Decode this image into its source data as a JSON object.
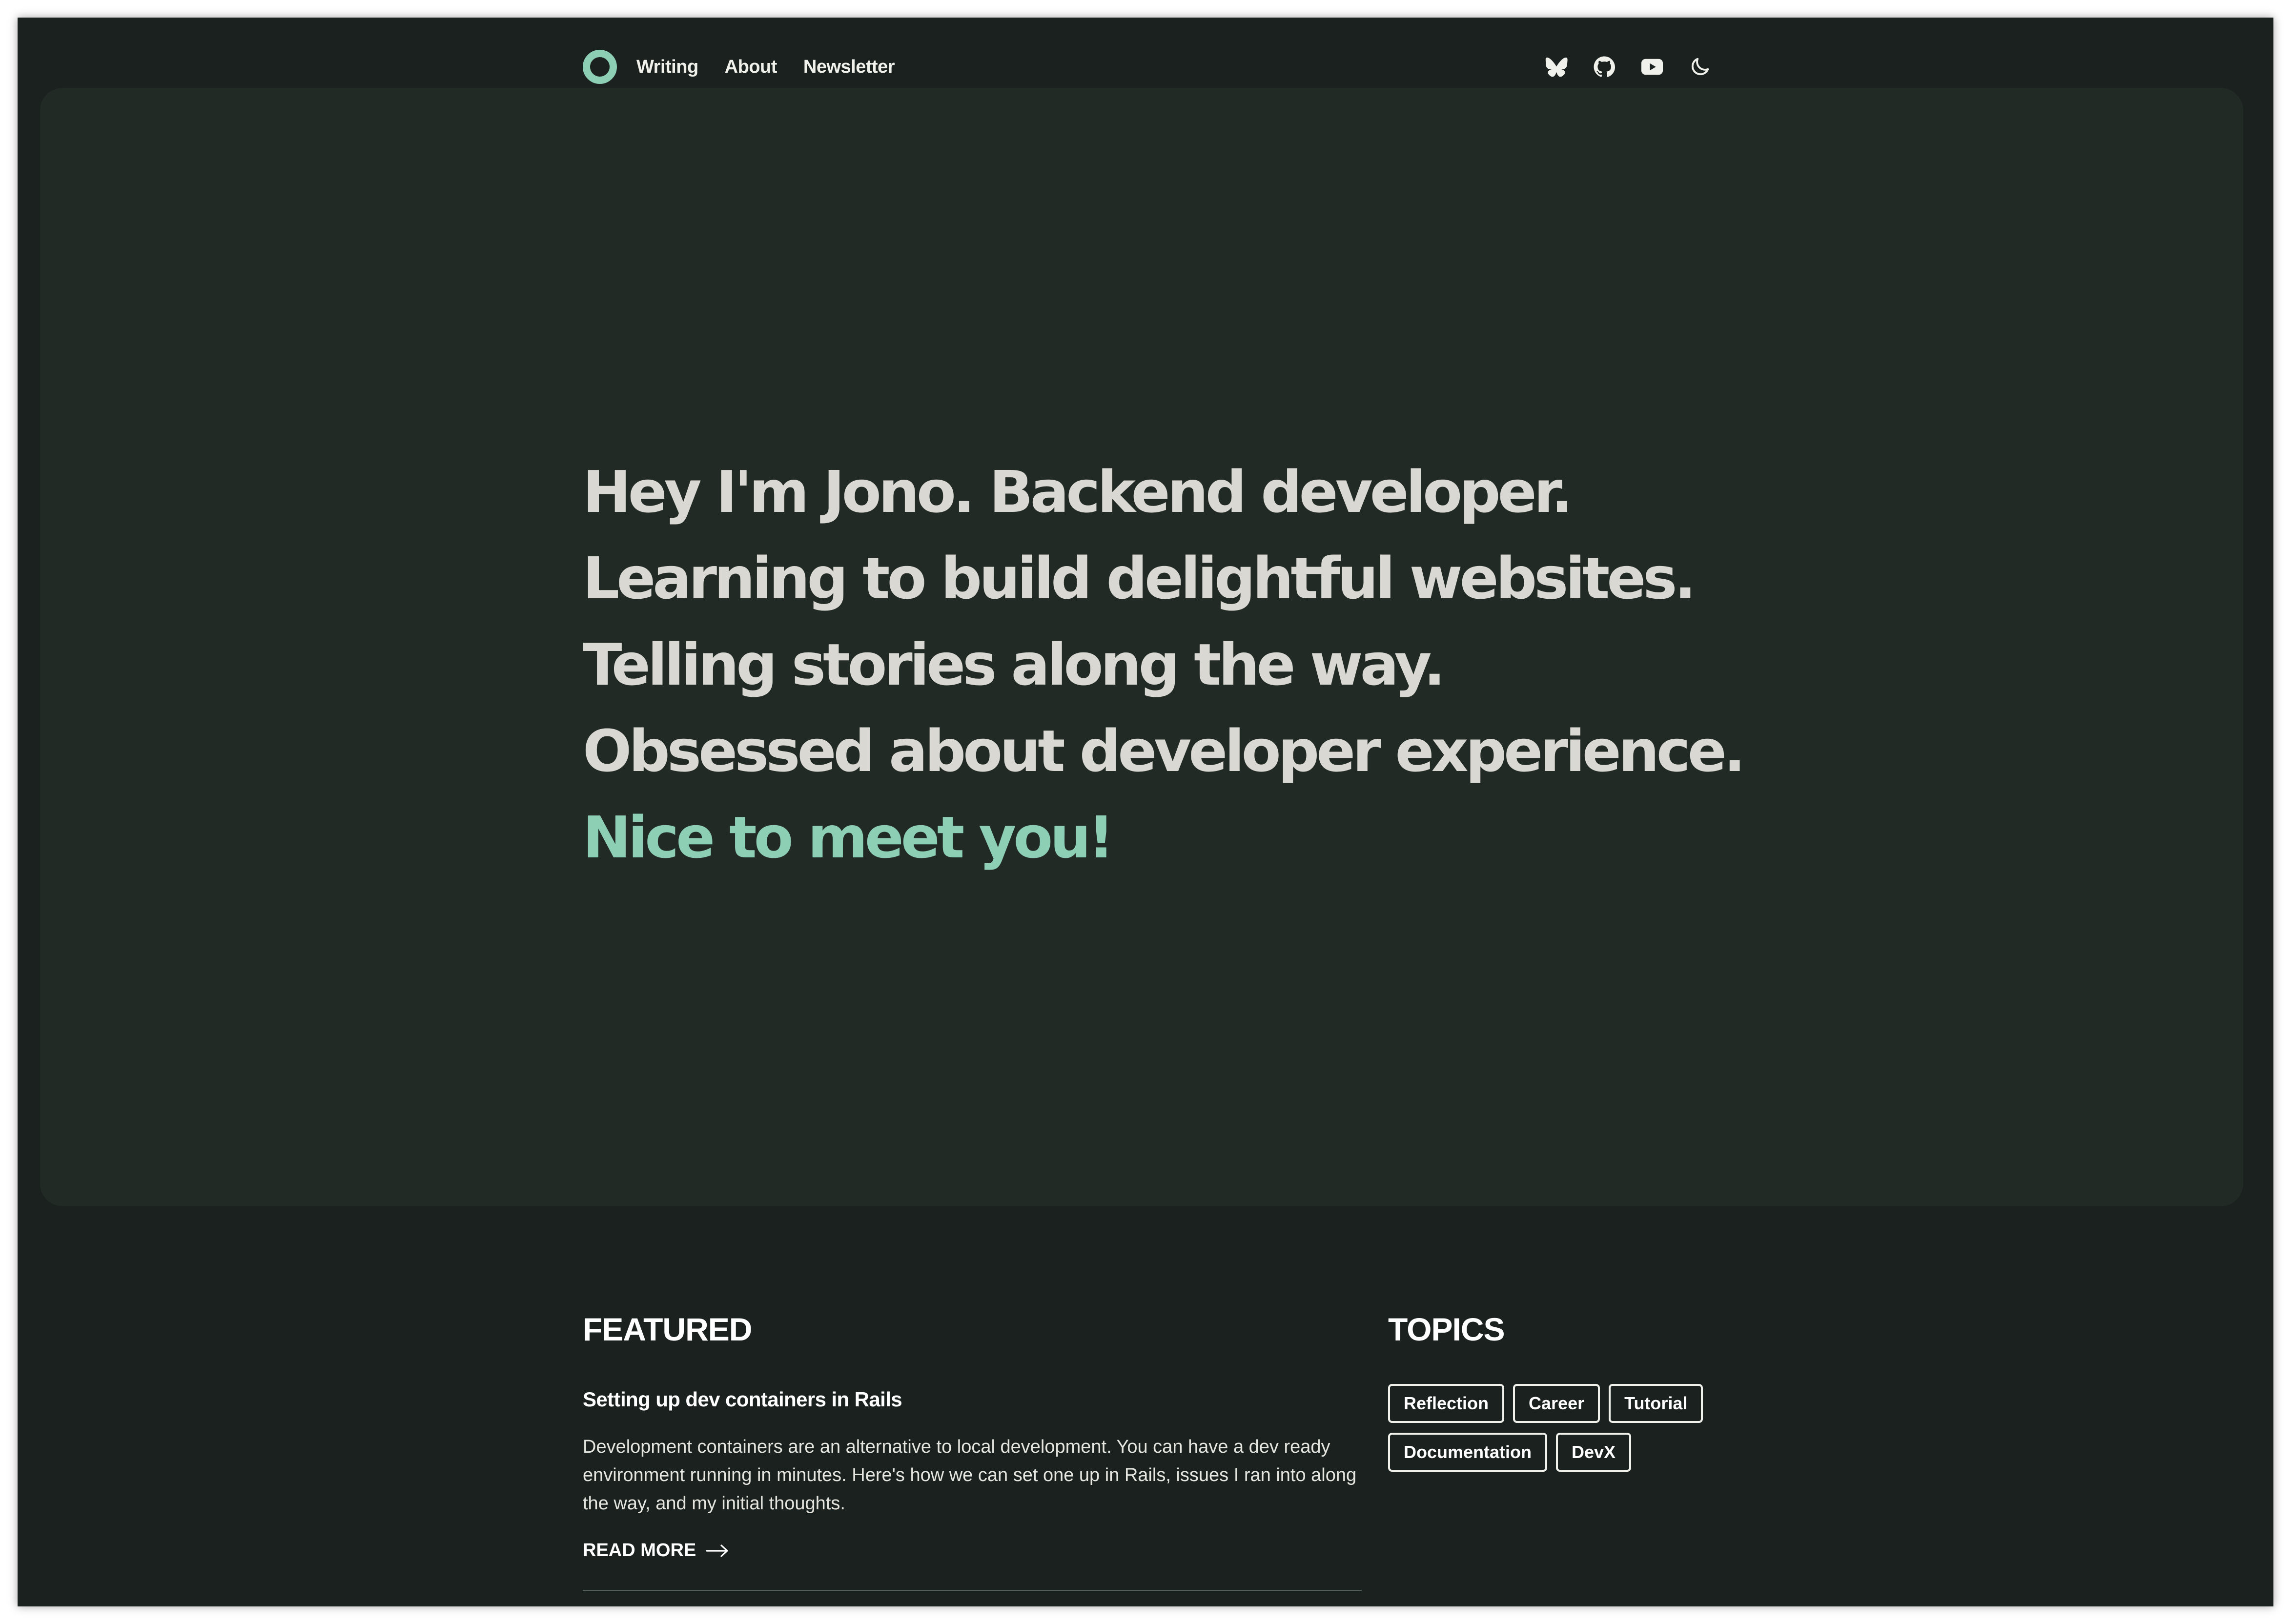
{
  "nav": {
    "links": [
      "Writing",
      "About",
      "Newsletter"
    ],
    "icons": [
      "butterfly-icon",
      "github-icon",
      "youtube-icon",
      "moon-icon"
    ]
  },
  "hero": {
    "lines": [
      "Hey I'm Jono. Backend developer.",
      "Learning to build delightful websites.",
      "Telling stories along the way.",
      "Obsessed about developer experience."
    ],
    "accent_line": "Nice to meet you!"
  },
  "featured": {
    "heading": "FEATURED",
    "post": {
      "title": "Setting up dev containers in Rails",
      "excerpt": "Development containers are an alternative to local development. You can have a dev ready environment running in minutes. Here's how we can set one up in Rails, issues I ran into along the way, and my initial thoughts.",
      "read_more": "READ MORE"
    }
  },
  "topics": {
    "heading": "TOPICS",
    "tags": [
      "Reflection",
      "Career",
      "Tutorial",
      "Documentation",
      "DevX"
    ]
  },
  "colors": {
    "background": "#1a211e",
    "hero_background": "#222a26",
    "accent": "#8ccfb4",
    "hero_text": "#d9d8d2"
  }
}
